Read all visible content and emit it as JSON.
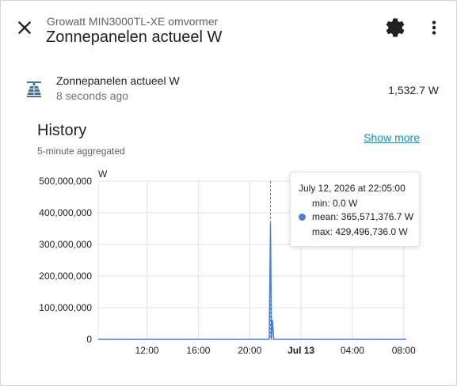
{
  "header": {
    "subtitle": "Growatt MIN3000TL-XE omvormer",
    "title": "Zonnepanelen actueel W",
    "close_icon": "close-icon",
    "settings_icon": "gear-icon",
    "more_icon": "more-vert-icon"
  },
  "entity": {
    "icon": "solar-panel-icon",
    "name": "Zonnepanelen actueel W",
    "last_changed": "8 seconds ago",
    "value": "1,532.7 W"
  },
  "history": {
    "title": "History",
    "subtitle": "5-minute aggregated",
    "show_more": "Show more"
  },
  "colors": {
    "accent": "#0597c4",
    "series": "#4b7fd8"
  },
  "chart_data": {
    "type": "line",
    "ylabel": "W",
    "ylim": [
      0,
      500000000
    ],
    "y_ticks": [
      "500,000,000",
      "400,000,000",
      "300,000,000",
      "200,000,000",
      "100,000,000",
      "0"
    ],
    "x_ticks": [
      "12:00",
      "16:00",
      "20:00",
      "Jul 13",
      "04:00",
      "08:00"
    ],
    "grid": true,
    "series": [
      {
        "x_hours": [
          8.2,
          21.4,
          21.52,
          21.62,
          21.7,
          21.78,
          21.88,
          22.0,
          32.2
        ],
        "values": [
          0,
          0,
          0,
          365571376.7,
          0,
          60000000,
          0,
          0,
          0
        ]
      }
    ],
    "tooltip": {
      "date": "July 12, 2026 at 22:05:00",
      "min": "min: 0.0 W",
      "mean": "mean: 365,571,376.7 W",
      "max": "max: 429,496,736.0 W"
    }
  }
}
